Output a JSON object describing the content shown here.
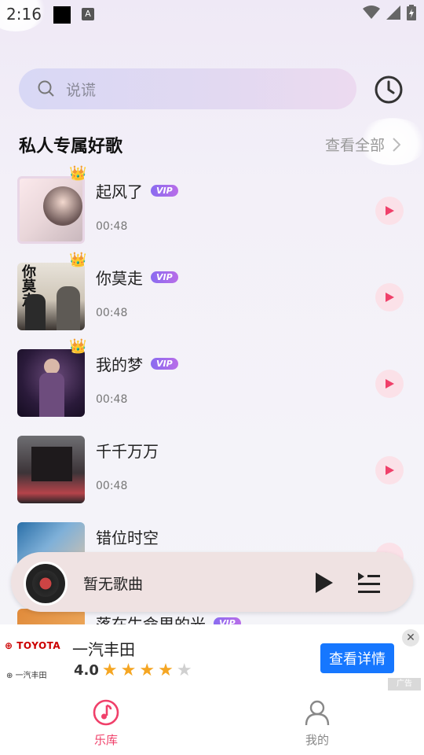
{
  "status_bar": {
    "time": "2:16",
    "a_icon": "A"
  },
  "search": {
    "placeholder": "说谎"
  },
  "section": {
    "title": "私人专属好歌",
    "see_all": "查看全部"
  },
  "songs": [
    {
      "title": "起风了",
      "vip": "VIP",
      "duration": "00:48"
    },
    {
      "title": "你莫走",
      "vip": "VIP",
      "duration": "00:48"
    },
    {
      "title": "我的梦",
      "vip": "VIP",
      "duration": "00:48"
    },
    {
      "title": "千千万万",
      "vip": "",
      "duration": "00:48"
    },
    {
      "title": "错位时空",
      "vip": "",
      "duration": ""
    },
    {
      "title": "落在生命里的光",
      "vip": "VIP",
      "duration": ""
    }
  ],
  "player": {
    "title": "暂无歌曲"
  },
  "ad": {
    "logo": "TOYOTA",
    "sub_logo": "一汽丰田",
    "brand": "一汽丰田",
    "rating": "4.0",
    "stars": 4,
    "button": "查看详情",
    "tag": "广告"
  },
  "nav": {
    "library": "乐库",
    "mine": "我的"
  },
  "colors": {
    "accent": "#f0406a",
    "vip": "#9b6cf0",
    "ad_button": "#1677ff"
  }
}
